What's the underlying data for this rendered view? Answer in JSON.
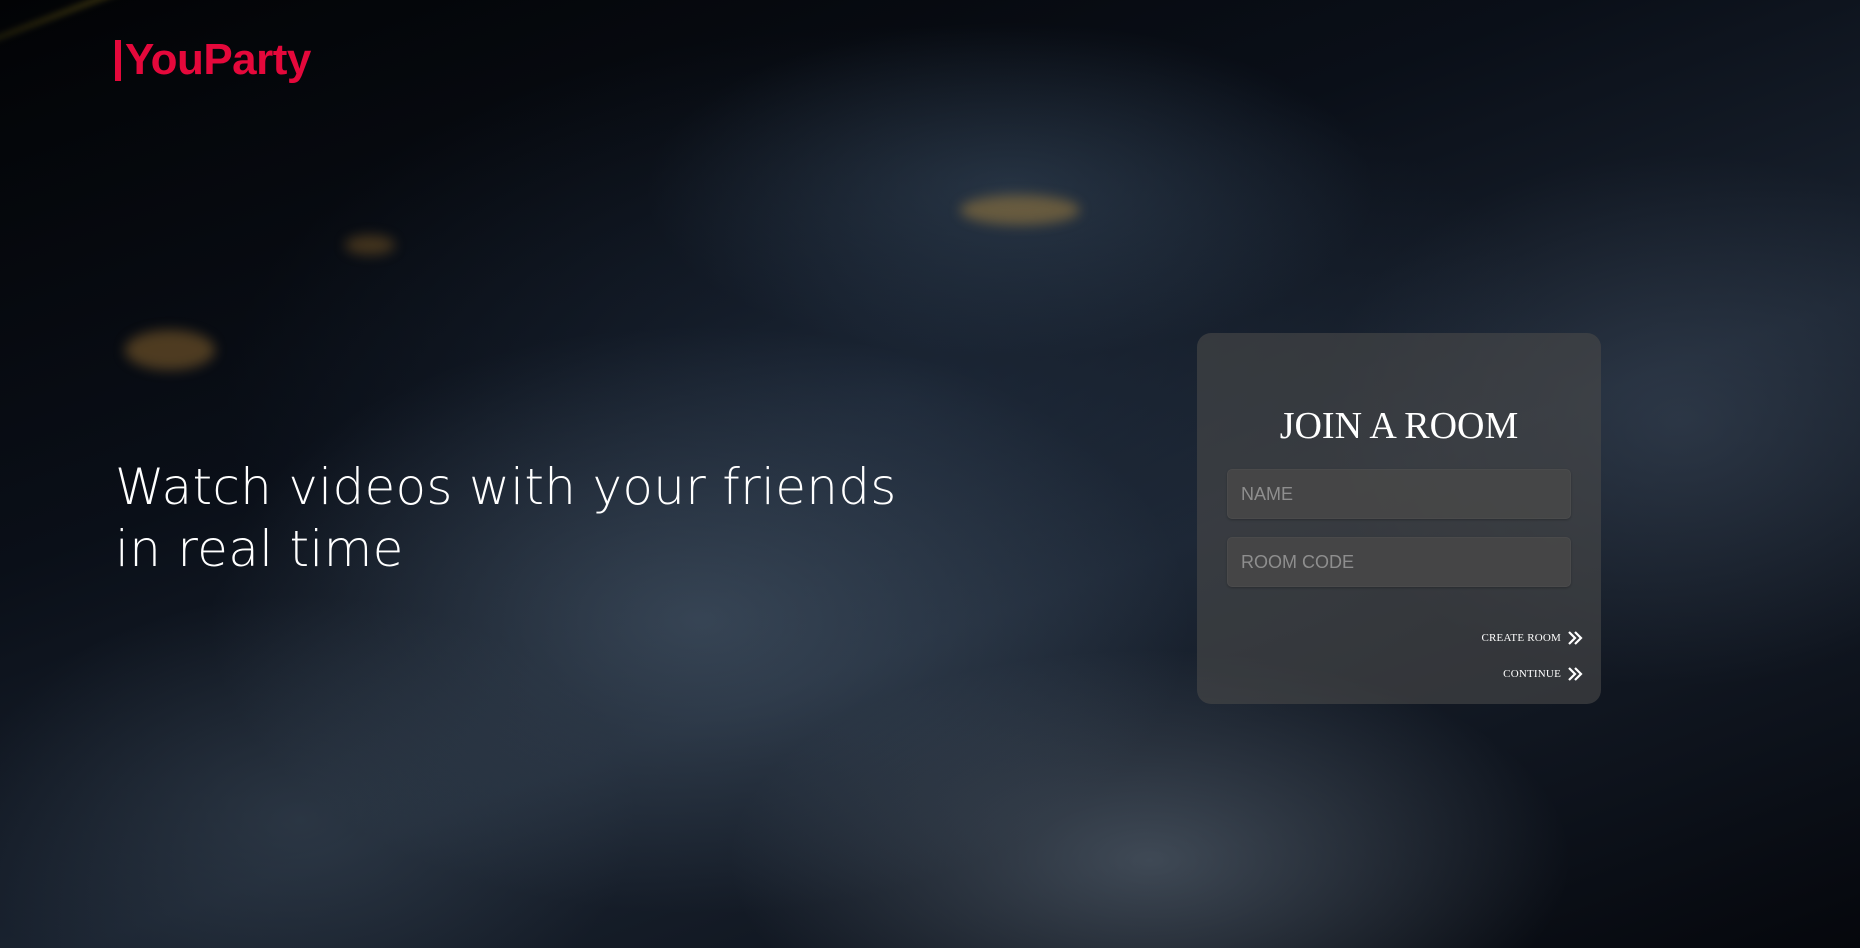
{
  "brand": {
    "name": "YouParty",
    "color": "#e5083b"
  },
  "hero": {
    "tagline": "Watch videos with your friends in real time"
  },
  "join_card": {
    "title": "JOIN A ROOM",
    "name_field": {
      "placeholder": "NAME",
      "value": ""
    },
    "room_code_field": {
      "placeholder": "ROOM CODE",
      "value": ""
    },
    "create_room_label": "CREATE ROOM",
    "create_room_icon": "double-chevron-right-icon",
    "continue_label": "CONTINUE",
    "continue_icon": "double-chevron-right-icon"
  }
}
